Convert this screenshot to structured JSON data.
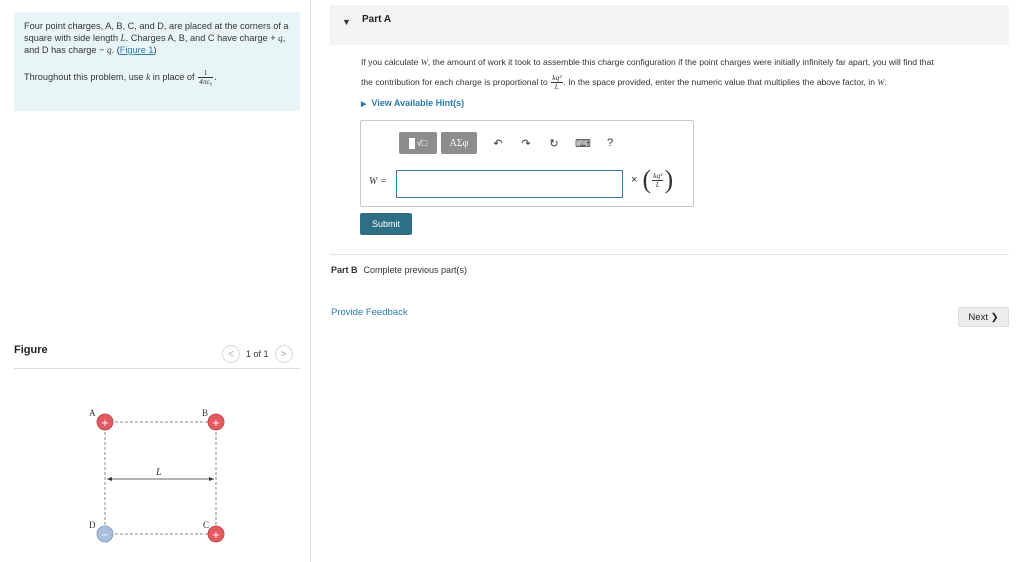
{
  "intro": {
    "p1_a": "Four point charges, A, B, C, and D, are placed at the corners of a square with side length ",
    "p1_L": "L",
    "p1_b": ". Charges A, B, and C have charge + ",
    "p1_q1": "q",
    "p1_c": ", and D has charge − ",
    "p1_q2": "q",
    "p1_d": ". (",
    "figure_link": "Figure 1",
    "p1_e": ")",
    "p2_a": "Throughout this problem, use ",
    "p2_k": "k",
    "p2_b": " in place of ",
    "p2_frac_num": "1",
    "p2_frac_den": "4πε₀",
    "p2_c": "."
  },
  "figure": {
    "title": "Figure",
    "page_indicator": "1 of 1",
    "prev_icon": "<",
    "next_icon": ">",
    "labels": {
      "A": "A",
      "B": "B",
      "C": "C",
      "D": "D",
      "L": "L"
    },
    "plus_sign": "+",
    "minus_sign": "−",
    "colors": {
      "positive": "#e35b60",
      "negative": "#a9bfdc"
    }
  },
  "part_a": {
    "caret": "▼",
    "label": "Part A",
    "question_a": "If you calculate ",
    "question_W": "W",
    "question_b": ", the amount of work it took to assemble this charge configuration if the point charges were initially infinitely far apart, you will find that",
    "question_c": "the contribution for each charge is proportional to ",
    "question_frac_num": "kq²",
    "question_frac_den": "L",
    "question_d": ". In the space provided, enter the numeric value that multiplies the above factor, in ",
    "question_W2": "W",
    "question_e": ".",
    "hint_icon": "▶",
    "hint": "View Available Hint(s)",
    "toolbar": {
      "sqrt_label": "√□",
      "greek_label": "ΑΣφ",
      "undo_icon": "↶",
      "redo_icon": "↷",
      "reset_icon": "↻",
      "keyboard_icon": "⌨",
      "help_label": "?"
    },
    "answer_label": "W =",
    "answer_value": "",
    "units_times": "×",
    "units_num": "kq²",
    "units_den": "L",
    "submit": "Submit"
  },
  "part_b": {
    "label": "Part B",
    "status": "Complete previous part(s)"
  },
  "feedback": "Provide Feedback",
  "next": "Next ❯"
}
